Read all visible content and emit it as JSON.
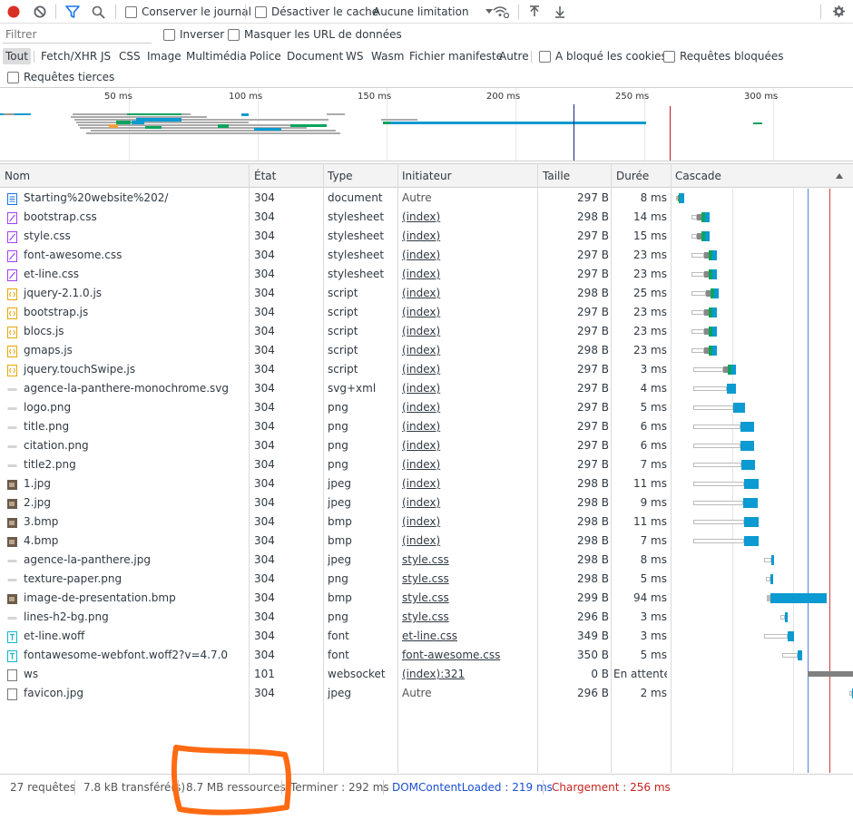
{
  "toolbar": {
    "preserve_log_label": "Conserver le journal",
    "disable_cache_label": "Désactiver le cache",
    "throttle_value": "Aucune limitation"
  },
  "filterbar": {
    "filter_placeholder": "Filtrer",
    "invert_label": "Inverser",
    "hide_data_urls_label": "Masquer les URL de données"
  },
  "types": [
    "Tout",
    "Fetch/XHR",
    "JS",
    "CSS",
    "Image",
    "Multimédia",
    "Police",
    "Document",
    "WS",
    "Wasm",
    "Fichier manifeste",
    "Autre"
  ],
  "types_active": "Tout",
  "blocked_cookies_label": "A bloqué les cookies",
  "blocked_requests_label": "Requêtes bloquées",
  "third_party_label": "Requêtes tierces",
  "overview_ticks": [
    "50 ms",
    "100 ms",
    "150 ms",
    "200 ms",
    "250 ms",
    "300 ms"
  ],
  "columns": {
    "name": "Nom",
    "status": "État",
    "type": "Type",
    "initiator": "Initiateur",
    "size": "Taille",
    "time": "Durée",
    "waterfall": "Cascade"
  },
  "rows": [
    {
      "name": "Starting%20website%202/",
      "icon": "document-icon",
      "status": "304",
      "type": "document",
      "initiator": "Autre",
      "init_link": false,
      "size": "297 B",
      "time": "8 ms",
      "wf": [
        3,
        10
      ]
    },
    {
      "name": "bootstrap.css",
      "icon": "stylesheet-icon",
      "status": "304",
      "type": "stylesheet",
      "initiator": "(index)",
      "init_link": true,
      "size": "298 B",
      "time": "14 ms",
      "wf": [
        20,
        40
      ]
    },
    {
      "name": "style.css",
      "icon": "stylesheet-icon",
      "status": "304",
      "type": "stylesheet",
      "initiator": "(index)",
      "init_link": true,
      "size": "297 B",
      "time": "15 ms",
      "wf": [
        20,
        40
      ]
    },
    {
      "name": "font-awesome.css",
      "icon": "stylesheet-icon",
      "status": "304",
      "type": "stylesheet",
      "initiator": "(index)",
      "init_link": true,
      "size": "297 B",
      "time": "23 ms",
      "wf": [
        20,
        48
      ]
    },
    {
      "name": "et-line.css",
      "icon": "stylesheet-icon",
      "status": "304",
      "type": "stylesheet",
      "initiator": "(index)",
      "init_link": true,
      "size": "297 B",
      "time": "23 ms",
      "wf": [
        20,
        48
      ]
    },
    {
      "name": "jquery-2.1.0.js",
      "icon": "script-icon",
      "status": "304",
      "type": "script",
      "initiator": "(index)",
      "init_link": true,
      "size": "298 B",
      "time": "25 ms",
      "wf": [
        20,
        50
      ]
    },
    {
      "name": "bootstrap.js",
      "icon": "script-icon",
      "status": "304",
      "type": "script",
      "initiator": "(index)",
      "init_link": true,
      "size": "297 B",
      "time": "23 ms",
      "wf": [
        20,
        48
      ]
    },
    {
      "name": "blocs.js",
      "icon": "script-icon",
      "status": "304",
      "type": "script",
      "initiator": "(index)",
      "init_link": true,
      "size": "297 B",
      "time": "23 ms",
      "wf": [
        20,
        48
      ]
    },
    {
      "name": "gmaps.js",
      "icon": "script-icon",
      "status": "304",
      "type": "script",
      "initiator": "(index)",
      "init_link": true,
      "size": "298 B",
      "time": "23 ms",
      "wf": [
        20,
        48
      ]
    },
    {
      "name": "jquery.touchSwipe.js",
      "icon": "script-icon",
      "status": "304",
      "type": "script",
      "initiator": "(index)",
      "init_link": true,
      "size": "297 B",
      "time": "3 ms",
      "wf": [
        22,
        69
      ]
    },
    {
      "name": "agence-la-panthere-monochrome.svg",
      "icon": "image-icon",
      "status": "304",
      "type": "svg+xml",
      "initiator": "(index)",
      "init_link": true,
      "size": "297 B",
      "time": "4 ms",
      "wf": [
        22,
        69
      ]
    },
    {
      "name": "logo.png",
      "icon": "image-icon",
      "status": "304",
      "type": "png",
      "initiator": "(index)",
      "init_link": true,
      "size": "297 B",
      "time": "5 ms",
      "wf": [
        22,
        79
      ]
    },
    {
      "name": "title.png",
      "icon": "image-icon",
      "status": "304",
      "type": "png",
      "initiator": "(index)",
      "init_link": true,
      "size": "297 B",
      "time": "6 ms",
      "wf": [
        22,
        89
      ]
    },
    {
      "name": "citation.png",
      "icon": "image-icon",
      "status": "304",
      "type": "png",
      "initiator": "(index)",
      "init_link": true,
      "size": "297 B",
      "time": "6 ms",
      "wf": [
        22,
        89
      ]
    },
    {
      "name": "title2.png",
      "icon": "image-icon",
      "status": "304",
      "type": "png",
      "initiator": "(index)",
      "init_link": true,
      "size": "297 B",
      "time": "7 ms",
      "wf": [
        22,
        90
      ]
    },
    {
      "name": "1.jpg",
      "icon": "photo-thumbnail-icon",
      "status": "304",
      "type": "jpeg",
      "initiator": "(index)",
      "init_link": true,
      "size": "298 B",
      "time": "11 ms",
      "wf": [
        22,
        94
      ]
    },
    {
      "name": "2.jpg",
      "icon": "photo-thumbnail-icon",
      "status": "304",
      "type": "jpeg",
      "initiator": "(index)",
      "init_link": true,
      "size": "298 B",
      "time": "9 ms",
      "wf": [
        22,
        93
      ]
    },
    {
      "name": "3.bmp",
      "icon": "photo-thumbnail-icon",
      "status": "304",
      "type": "bmp",
      "initiator": "(index)",
      "init_link": true,
      "size": "298 B",
      "time": "11 ms",
      "wf": [
        22,
        94
      ]
    },
    {
      "name": "4.bmp",
      "icon": "photo-thumbnail-icon",
      "status": "304",
      "type": "bmp",
      "initiator": "(index)",
      "init_link": true,
      "size": "298 B",
      "time": "7 ms",
      "wf": [
        22,
        94
      ]
    },
    {
      "name": "agence-la-panthere.jpg",
      "icon": "image-icon",
      "status": "304",
      "type": "jpeg",
      "initiator": "style.css",
      "init_link": true,
      "size": "298 B",
      "time": "8 ms",
      "wf": [
        100,
        110
      ]
    },
    {
      "name": "texture-paper.png",
      "icon": "image-icon",
      "status": "304",
      "type": "png",
      "initiator": "style.css",
      "init_link": true,
      "size": "298 B",
      "time": "5 ms",
      "wf": [
        102,
        109
      ]
    },
    {
      "name": "image-de-presentation.bmp",
      "icon": "photo-thumbnail-icon",
      "status": "304",
      "type": "bmp",
      "initiator": "style.css",
      "init_link": true,
      "size": "299 B",
      "time": "94 ms",
      "wf": [
        103,
        169
      ]
    },
    {
      "name": "lines-h2-bg.png",
      "icon": "image-icon",
      "status": "304",
      "type": "png",
      "initiator": "style.css",
      "init_link": true,
      "size": "296 B",
      "time": "3 ms",
      "wf": [
        118,
        124
      ]
    },
    {
      "name": "et-line.woff",
      "icon": "font-icon",
      "status": "304",
      "type": "font",
      "initiator": "et-line.css",
      "init_link": true,
      "size": "349 B",
      "time": "3 ms",
      "wf": [
        100,
        133
      ]
    },
    {
      "name": "fontawesome-webfont.woff2?v=4.7.0",
      "icon": "font-icon",
      "status": "304",
      "type": "font",
      "initiator": "font-awesome.css",
      "init_link": true,
      "size": "350 B",
      "time": "5 ms",
      "wf": [
        120,
        142
      ]
    },
    {
      "name": "ws",
      "icon": "websocket-icon",
      "status": "101",
      "type": "websocket",
      "initiator": "(index):321",
      "init_link": true,
      "size": "0 B",
      "time": "En attente",
      "wf": [
        148,
        198
      ]
    },
    {
      "name": "favicon.jpg",
      "icon": "websocket-icon",
      "status": "304",
      "type": "jpeg",
      "initiator": "Autre",
      "init_link": false,
      "size": "296 B",
      "time": "2 ms",
      "wf": [
        194,
        198
      ]
    }
  ],
  "status": {
    "requests": "27 requêtes",
    "transferred": "7.8 kB transféré(s)",
    "resources": "8.7 MB ressources",
    "finish": "Terminer : 292 ms",
    "dom_content_loaded": "DOMContentLoaded : 219 ms",
    "load": "Chargement : 256 ms"
  },
  "colors": {
    "accent_record": "#d93025",
    "filter_active": "#1a73e8",
    "dom_content_loaded": "#1a4fd0",
    "load": "#c5221f",
    "bar_blue": "#0b9ad1",
    "bar_green": "#0ca45d",
    "highlight_annotation": "#ff6a13"
  }
}
